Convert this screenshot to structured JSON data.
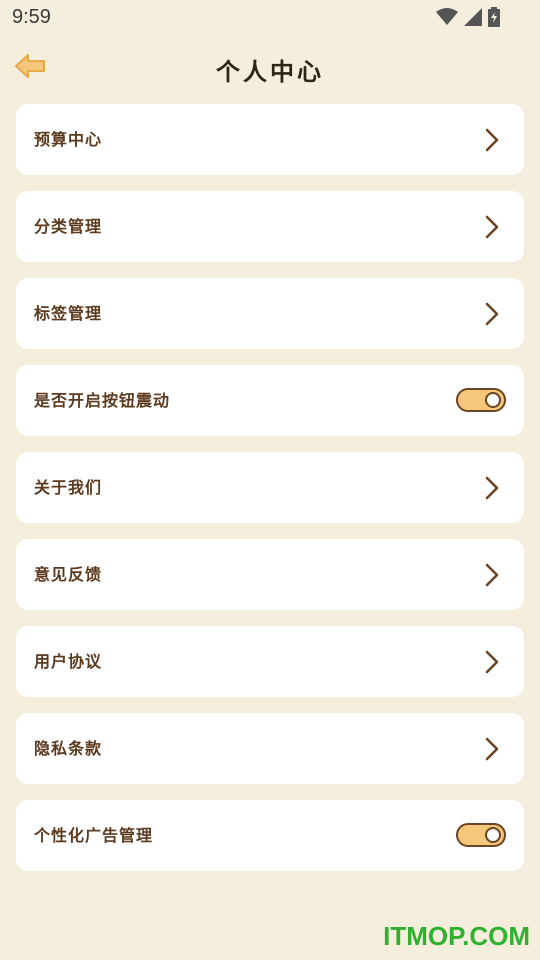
{
  "status_bar": {
    "time": "9:59",
    "icons": [
      "wifi-icon",
      "signal-icon",
      "battery-icon"
    ]
  },
  "header": {
    "title": "个人中心",
    "back_icon": "back-arrow-icon"
  },
  "menu": {
    "items": [
      {
        "label": "预算中心",
        "type": "link"
      },
      {
        "label": "分类管理",
        "type": "link"
      },
      {
        "label": "标签管理",
        "type": "link"
      },
      {
        "label": "是否开启按钮震动",
        "type": "toggle",
        "value": true
      },
      {
        "label": "关于我们",
        "type": "link"
      },
      {
        "label": "意见反馈",
        "type": "link"
      },
      {
        "label": "用户协议",
        "type": "link"
      },
      {
        "label": "隐私条款",
        "type": "link"
      },
      {
        "label": "个性化广告管理",
        "type": "toggle",
        "value": true
      }
    ]
  },
  "colors": {
    "background": "#F5EEDC",
    "card": "#FFFFFF",
    "text": "#5B3A1E",
    "accent": "#F5C77A",
    "watermark": "#2FB02F"
  },
  "watermark": "ITMOP.COM"
}
